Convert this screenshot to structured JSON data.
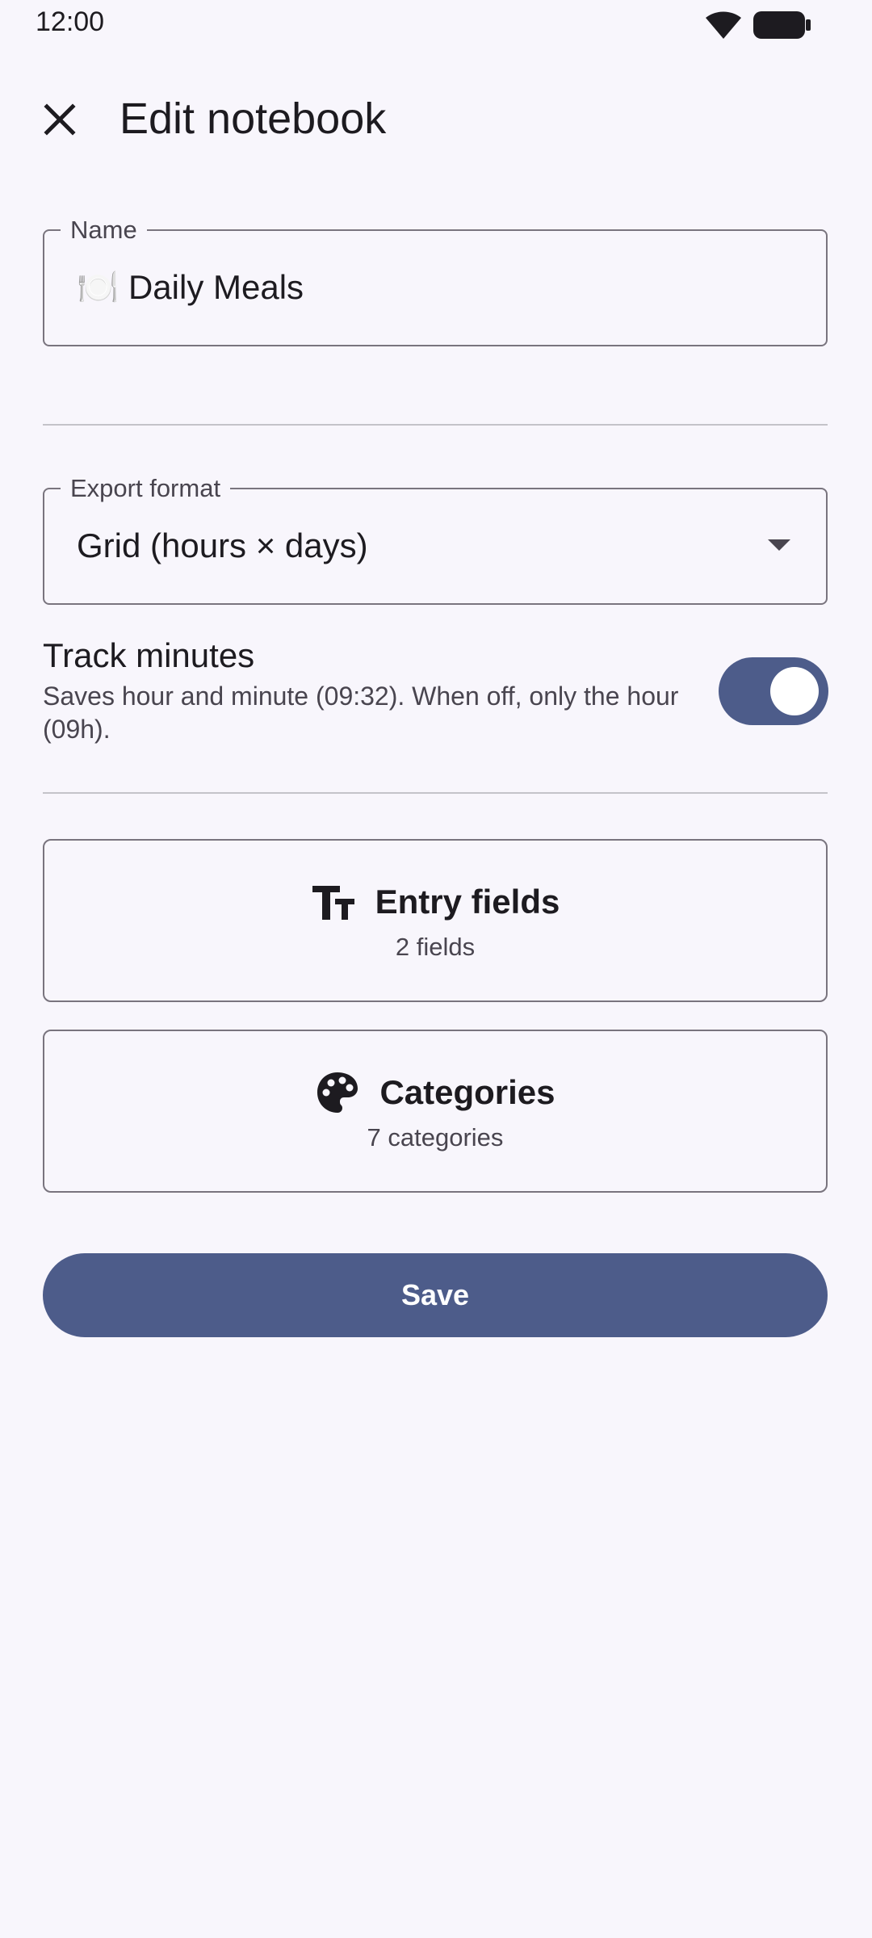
{
  "status_bar": {
    "time": "12:00",
    "icons": [
      "wifi-icon",
      "battery-icon"
    ]
  },
  "app_bar": {
    "close_icon": "close-icon",
    "title": "Edit notebook"
  },
  "name_field": {
    "label": "Name",
    "value": "🍽️ Daily Meals"
  },
  "export_field": {
    "label": "Export format",
    "value": "Grid (hours × days)"
  },
  "track_minutes": {
    "title": "Track minutes",
    "description": "Saves hour and minute (09:32). When off, only the hour (09h).",
    "enabled": true
  },
  "entry_fields_card": {
    "icon": "text-fields-icon",
    "title": "Entry fields",
    "subtitle": "2 fields"
  },
  "categories_card": {
    "icon": "palette-icon",
    "title": "Categories",
    "subtitle": "7 categories"
  },
  "save_button": {
    "label": "Save"
  },
  "colors": {
    "background": "#f8f6fc",
    "primary": "#4d5c8a",
    "outline": "#79747e",
    "on_surface": "#1d1b20",
    "on_surface_variant": "#49454f"
  }
}
